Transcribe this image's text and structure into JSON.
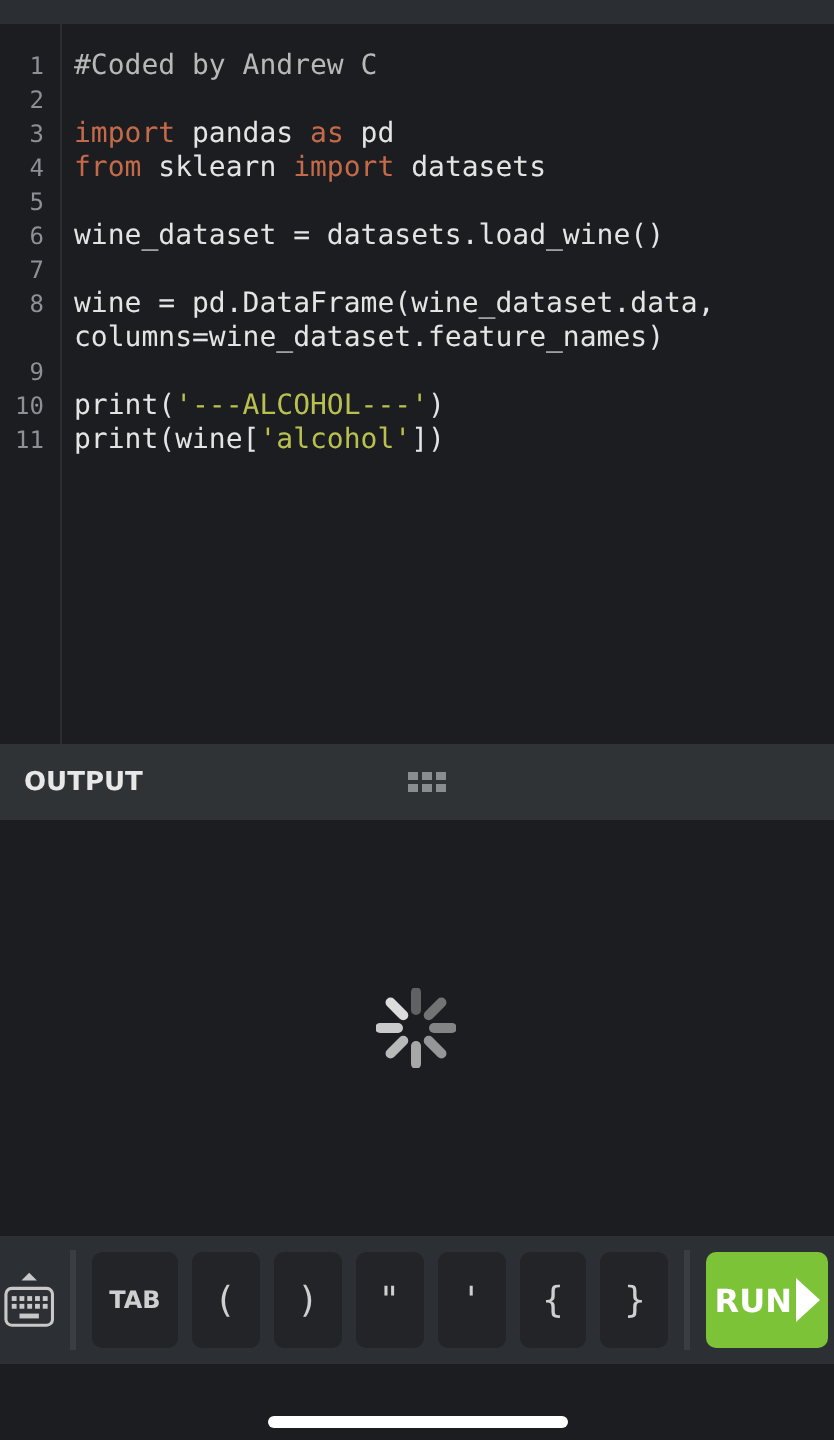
{
  "editor": {
    "lines": [
      {
        "number": "1",
        "rows": [
          [
            {
              "kind": "comment",
              "text": "#Coded by Andrew C"
            }
          ]
        ]
      },
      {
        "number": "2",
        "rows": [
          []
        ]
      },
      {
        "number": "3",
        "rows": [
          [
            {
              "kind": "keyword",
              "text": "import"
            },
            {
              "kind": "plain",
              "text": " pandas "
            },
            {
              "kind": "keyword",
              "text": "as"
            },
            {
              "kind": "plain",
              "text": " pd"
            }
          ]
        ]
      },
      {
        "number": "4",
        "rows": [
          [
            {
              "kind": "keyword",
              "text": "from"
            },
            {
              "kind": "plain",
              "text": " sklearn "
            },
            {
              "kind": "keyword",
              "text": "import"
            },
            {
              "kind": "plain",
              "text": " datasets"
            }
          ]
        ]
      },
      {
        "number": "5",
        "rows": [
          []
        ]
      },
      {
        "number": "6",
        "rows": [
          [
            {
              "kind": "plain",
              "text": "wine_dataset = datasets.load_wine()"
            }
          ]
        ]
      },
      {
        "number": "7",
        "rows": [
          []
        ]
      },
      {
        "number": "8",
        "rows": [
          [
            {
              "kind": "plain",
              "text": "wine = pd.DataFrame(wine_dataset.data,"
            }
          ],
          [
            {
              "kind": "plain",
              "text": "columns=wine_dataset.feature_names)"
            }
          ]
        ]
      },
      {
        "number": "9",
        "rows": [
          []
        ]
      },
      {
        "number": "10",
        "rows": [
          [
            {
              "kind": "plain",
              "text": "print("
            },
            {
              "kind": "string",
              "text": "'---ALCOHOL---'"
            },
            {
              "kind": "plain",
              "text": ")"
            }
          ]
        ]
      },
      {
        "number": "11",
        "rows": [
          [
            {
              "kind": "plain",
              "text": "print(wine["
            },
            {
              "kind": "string",
              "text": "'alcohol'"
            },
            {
              "kind": "plain",
              "text": "])"
            }
          ]
        ]
      }
    ]
  },
  "output": {
    "title": "OUTPUT",
    "loading": true
  },
  "toolbar": {
    "keys": [
      "TAB",
      "(",
      ")",
      "\"",
      "'",
      "{",
      "}"
    ],
    "run": "RUN"
  }
}
